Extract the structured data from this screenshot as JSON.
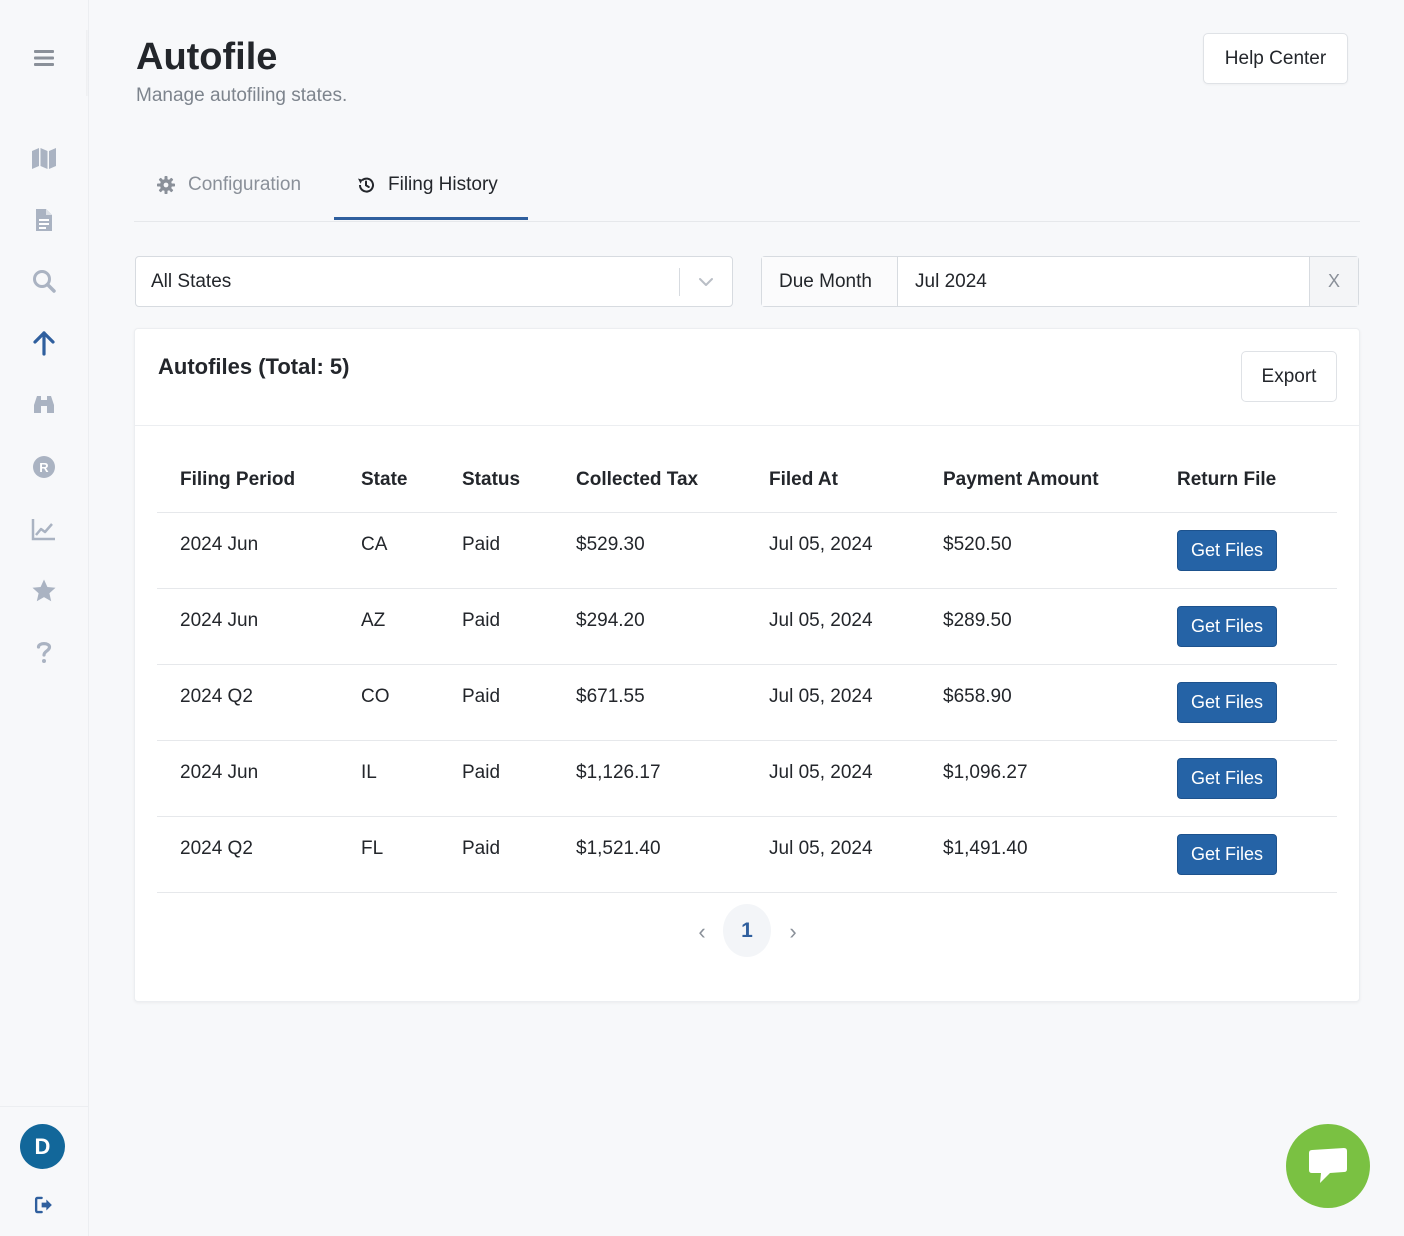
{
  "app": {
    "title": "Autofile",
    "subtitle": "Manage autofiling states.",
    "help_label": "Help Center"
  },
  "sidebar": {
    "items": [
      {
        "icon": "menu-icon"
      },
      {
        "icon": "map-icon"
      },
      {
        "icon": "document-icon"
      },
      {
        "icon": "search-icon"
      },
      {
        "icon": "arrow-up-icon",
        "active": true
      },
      {
        "icon": "binoculars-icon"
      },
      {
        "icon": "registered-icon"
      },
      {
        "icon": "chart-line-icon"
      },
      {
        "icon": "star-icon"
      },
      {
        "icon": "question-icon"
      }
    ],
    "avatar_initial": "D",
    "logout_icon": "logout-icon"
  },
  "tabs": [
    {
      "label": "Configuration",
      "icon": "gear-icon",
      "active": false
    },
    {
      "label": "Filing History",
      "icon": "history-icon",
      "active": true
    }
  ],
  "filters": {
    "state_value": "All States",
    "due_label": "Due Month",
    "due_value": "Jul 2024",
    "clear_label": "X"
  },
  "card": {
    "title": "Autofiles (Total: 5)",
    "export_label": "Export"
  },
  "table": {
    "columns": [
      "Filing Period",
      "State",
      "Status",
      "Collected Tax",
      "Filed At",
      "Payment Amount",
      "Return File"
    ],
    "rows": [
      {
        "period": "2024 Jun",
        "state": "CA",
        "status": "Paid",
        "collected": "$529.30",
        "filed": "Jul 05, 2024",
        "payment": "$520.50",
        "action": "Get Files"
      },
      {
        "period": "2024 Jun",
        "state": "AZ",
        "status": "Paid",
        "collected": "$294.20",
        "filed": "Jul 05, 2024",
        "payment": "$289.50",
        "action": "Get Files"
      },
      {
        "period": "2024 Q2",
        "state": "CO",
        "status": "Paid",
        "collected": "$671.55",
        "filed": "Jul 05, 2024",
        "payment": "$658.90",
        "action": "Get Files"
      },
      {
        "period": "2024 Jun",
        "state": "IL",
        "status": "Paid",
        "collected": "$1,126.17",
        "filed": "Jul 05, 2024",
        "payment": "$1,096.27",
        "action": "Get Files"
      },
      {
        "period": "2024 Q2",
        "state": "FL",
        "status": "Paid",
        "collected": "$1,521.40",
        "filed": "Jul 05, 2024",
        "payment": "$1,491.40",
        "action": "Get Files"
      }
    ]
  },
  "pagination": {
    "prev": "‹",
    "current": "1",
    "next": "›"
  },
  "colors": {
    "accent": "#2f5f9e",
    "button_primary": "#2563a6",
    "avatar": "#12679a",
    "chat": "#7ac142"
  }
}
